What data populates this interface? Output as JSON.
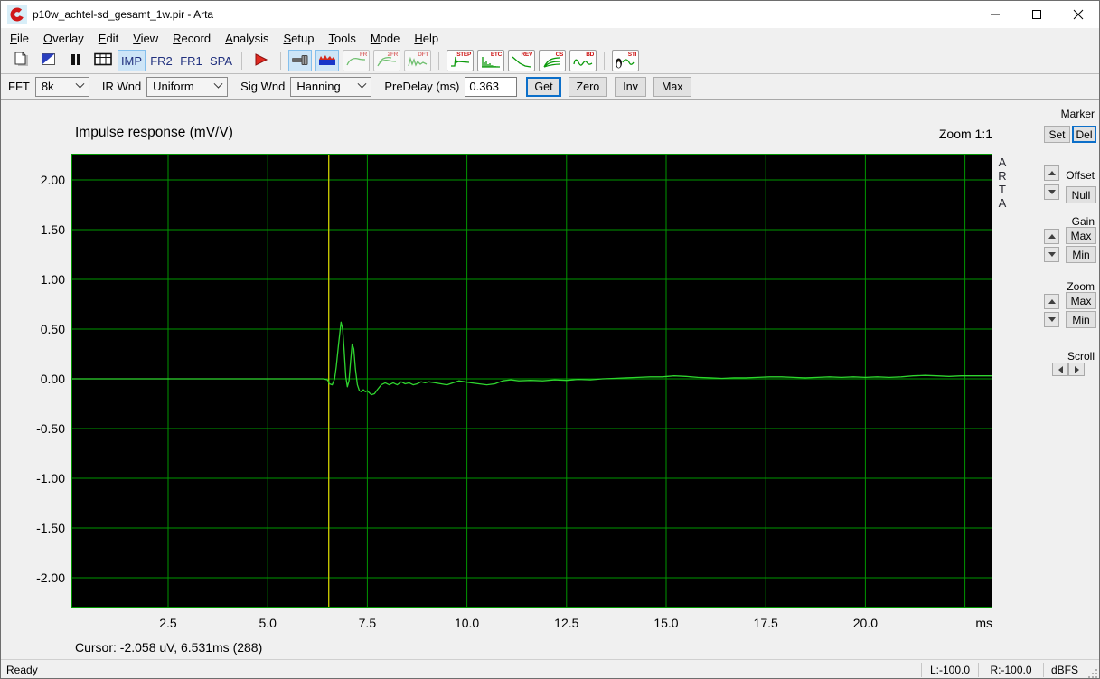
{
  "window": {
    "title": "p10w_achtel-sd_gesamt_1w.pir - Arta",
    "controls": {
      "minimize": "minimize",
      "maximize": "maximize",
      "close": "close"
    }
  },
  "menu": {
    "items": [
      "File",
      "Overlay",
      "Edit",
      "View",
      "Record",
      "Analysis",
      "Setup",
      "Tools",
      "Mode",
      "Help"
    ]
  },
  "toolbar": {
    "items": [
      {
        "kind": "icon",
        "name": "new-document",
        "icon": "new"
      },
      {
        "kind": "icon",
        "name": "overlay-manager",
        "icon": "overlay"
      },
      {
        "kind": "icon",
        "name": "pause",
        "icon": "pause"
      },
      {
        "kind": "icon",
        "name": "data-table",
        "icon": "table"
      },
      {
        "kind": "text",
        "label": "IMP",
        "active": true
      },
      {
        "kind": "text",
        "label": "FR2",
        "active": false
      },
      {
        "kind": "text",
        "label": "FR1",
        "active": false
      },
      {
        "kind": "text",
        "label": "SPA",
        "active": false
      },
      {
        "kind": "sep"
      },
      {
        "kind": "icon",
        "name": "record-play",
        "icon": "play"
      },
      {
        "kind": "sep"
      },
      {
        "kind": "icon",
        "name": "signal-generator",
        "icon": "generator",
        "active": true
      },
      {
        "kind": "icon",
        "name": "signal-time-record",
        "icon": "waveform",
        "active": true
      },
      {
        "kind": "chart",
        "label": "FR",
        "name": "frequency-response",
        "disabled": true
      },
      {
        "kind": "chart",
        "label": "2FR",
        "name": "dual-frequency-response",
        "disabled": true
      },
      {
        "kind": "chart",
        "label": "DFT",
        "name": "dft-spectrum",
        "disabled": true
      },
      {
        "kind": "sep"
      },
      {
        "kind": "chart",
        "label": "STEP",
        "name": "step-response",
        "disabled": false
      },
      {
        "kind": "chart",
        "label": "ETC",
        "name": "energy-time-curve",
        "disabled": false
      },
      {
        "kind": "chart",
        "label": "REV",
        "name": "reverberation",
        "disabled": false
      },
      {
        "kind": "chart",
        "label": "CS",
        "name": "cumulative-spectrum",
        "disabled": false
      },
      {
        "kind": "chart",
        "label": "BD",
        "name": "burst-decay",
        "disabled": false
      },
      {
        "kind": "sep"
      },
      {
        "kind": "chart",
        "label": "STI",
        "name": "speech-intelligibility",
        "disabled": false
      }
    ]
  },
  "settings": {
    "fft_label": "FFT",
    "fft_value": "8k",
    "ir_wnd_label": "IR Wnd",
    "ir_wnd_value": "Uniform",
    "sig_wnd_label": "Sig Wnd",
    "sig_wnd_value": "Hanning",
    "predelay_label": "PreDelay (ms)",
    "predelay_value": "0.363",
    "get_label": "Get",
    "zero_label": "Zero",
    "inv_label": "Inv",
    "max_label": "Max"
  },
  "chart": {
    "zoom_label": "Zoom 1:1",
    "watermark": "ARTA",
    "cursor_readout": "Cursor: -2.058 uV, 6.531ms (288)"
  },
  "chart_data": {
    "type": "line",
    "title": "Impulse response (mV/V)",
    "xlabel": "ms",
    "ylabel": "mV/V",
    "xlim": [
      0.073,
      23.19
    ],
    "ylim": [
      -2.3,
      2.264
    ],
    "grid": true,
    "cursor_ms": 6.531,
    "colors": {
      "plot_bg": "#000000",
      "grid": "#009600",
      "curve": "#2fd52f",
      "cursor": "#c2c200"
    },
    "x_ticks": [
      {
        "v": 2.5,
        "label": "2.5"
      },
      {
        "v": 5.0,
        "label": "5.0"
      },
      {
        "v": 7.5,
        "label": "7.5"
      },
      {
        "v": 10.0,
        "label": "10.0"
      },
      {
        "v": 12.5,
        "label": "12.5"
      },
      {
        "v": 15.0,
        "label": "15.0"
      },
      {
        "v": 17.5,
        "label": "17.5"
      },
      {
        "v": 20.0,
        "label": "20.0"
      },
      {
        "v": 22.5,
        "label": ""
      }
    ],
    "y_ticks": [
      {
        "v": 2.0,
        "label": "2.00"
      },
      {
        "v": 1.5,
        "label": "1.50"
      },
      {
        "v": 1.0,
        "label": "1.00"
      },
      {
        "v": 0.5,
        "label": "0.50"
      },
      {
        "v": 0.0,
        "label": "0.00"
      },
      {
        "v": -0.5,
        "label": "-0.50"
      },
      {
        "v": -1.0,
        "label": "-1.00"
      },
      {
        "v": -1.5,
        "label": "-1.50"
      },
      {
        "v": -2.0,
        "label": "-2.00"
      }
    ],
    "series": [
      {
        "name": "impulse-response",
        "points": [
          [
            0.073,
            0
          ],
          [
            1.0,
            0
          ],
          [
            2.0,
            0
          ],
          [
            3.0,
            0
          ],
          [
            4.0,
            0
          ],
          [
            5.0,
            0
          ],
          [
            5.8,
            0
          ],
          [
            6.2,
            0
          ],
          [
            6.4,
            0
          ],
          [
            6.5,
            -0.01
          ],
          [
            6.55,
            -0.05
          ],
          [
            6.62,
            -0.06
          ],
          [
            6.68,
            0.0
          ],
          [
            6.72,
            0.12
          ],
          [
            6.78,
            0.35
          ],
          [
            6.84,
            0.57
          ],
          [
            6.88,
            0.5
          ],
          [
            6.92,
            0.28
          ],
          [
            6.96,
            0.02
          ],
          [
            7.0,
            -0.08
          ],
          [
            7.04,
            -0.02
          ],
          [
            7.08,
            0.18
          ],
          [
            7.12,
            0.35
          ],
          [
            7.16,
            0.3
          ],
          [
            7.2,
            0.1
          ],
          [
            7.25,
            -0.06
          ],
          [
            7.3,
            -0.12
          ],
          [
            7.35,
            -0.13
          ],
          [
            7.4,
            -0.11
          ],
          [
            7.45,
            -0.13
          ],
          [
            7.5,
            -0.12
          ],
          [
            7.55,
            -0.14
          ],
          [
            7.6,
            -0.16
          ],
          [
            7.68,
            -0.15
          ],
          [
            7.75,
            -0.11
          ],
          [
            7.85,
            -0.06
          ],
          [
            7.95,
            -0.04
          ],
          [
            8.05,
            -0.06
          ],
          [
            8.15,
            -0.04
          ],
          [
            8.25,
            -0.06
          ],
          [
            8.35,
            -0.03
          ],
          [
            8.45,
            -0.05
          ],
          [
            8.55,
            -0.04
          ],
          [
            8.65,
            -0.06
          ],
          [
            8.75,
            -0.05
          ],
          [
            8.85,
            -0.03
          ],
          [
            8.95,
            -0.04
          ],
          [
            9.05,
            -0.03
          ],
          [
            9.2,
            -0.04
          ],
          [
            9.35,
            -0.05
          ],
          [
            9.5,
            -0.06
          ],
          [
            9.65,
            -0.04
          ],
          [
            9.8,
            -0.02
          ],
          [
            9.95,
            -0.03
          ],
          [
            10.1,
            -0.04
          ],
          [
            10.3,
            -0.05
          ],
          [
            10.5,
            -0.06
          ],
          [
            10.7,
            -0.05
          ],
          [
            10.9,
            -0.02
          ],
          [
            11.1,
            -0.01
          ],
          [
            11.3,
            -0.02
          ],
          [
            11.6,
            -0.015
          ],
          [
            11.9,
            -0.02
          ],
          [
            12.2,
            -0.01
          ],
          [
            12.5,
            -0.015
          ],
          [
            12.8,
            -0.005
          ],
          [
            13.1,
            -0.01
          ],
          [
            13.4,
            0.0
          ],
          [
            13.7,
            0.005
          ],
          [
            14.0,
            0.01
          ],
          [
            14.3,
            0.015
          ],
          [
            14.6,
            0.02
          ],
          [
            14.9,
            0.02
          ],
          [
            15.2,
            0.03
          ],
          [
            15.5,
            0.025
          ],
          [
            15.8,
            0.015
          ],
          [
            16.1,
            0.01
          ],
          [
            16.4,
            0.005
          ],
          [
            16.7,
            0.01
          ],
          [
            17.0,
            0.01
          ],
          [
            17.3,
            0.015
          ],
          [
            17.6,
            0.02
          ],
          [
            17.9,
            0.02
          ],
          [
            18.2,
            0.015
          ],
          [
            18.5,
            0.01
          ],
          [
            18.8,
            0.015
          ],
          [
            19.1,
            0.02
          ],
          [
            19.4,
            0.015
          ],
          [
            19.7,
            0.02
          ],
          [
            20.0,
            0.015
          ],
          [
            20.3,
            0.02
          ],
          [
            20.6,
            0.015
          ],
          [
            20.9,
            0.02
          ],
          [
            21.2,
            0.03
          ],
          [
            21.5,
            0.035
          ],
          [
            21.8,
            0.03
          ],
          [
            22.1,
            0.025
          ],
          [
            22.4,
            0.03
          ],
          [
            22.7,
            0.03
          ],
          [
            23.0,
            0.03
          ],
          [
            23.19,
            0.03
          ]
        ]
      }
    ]
  },
  "right_panel": {
    "marker": {
      "title": "Marker",
      "set": "Set",
      "del": "Del"
    },
    "offset": {
      "title": "Offset",
      "null_label": "Null"
    },
    "gain": {
      "title": "Gain",
      "max": "Max",
      "min": "Min"
    },
    "zoom": {
      "title": "Zoom",
      "max": "Max",
      "min": "Min"
    },
    "scroll": {
      "title": "Scroll"
    }
  },
  "status_bar": {
    "ready": "Ready",
    "cells": [
      "L:-100.0",
      "R:-100.0",
      "dBFS"
    ]
  }
}
